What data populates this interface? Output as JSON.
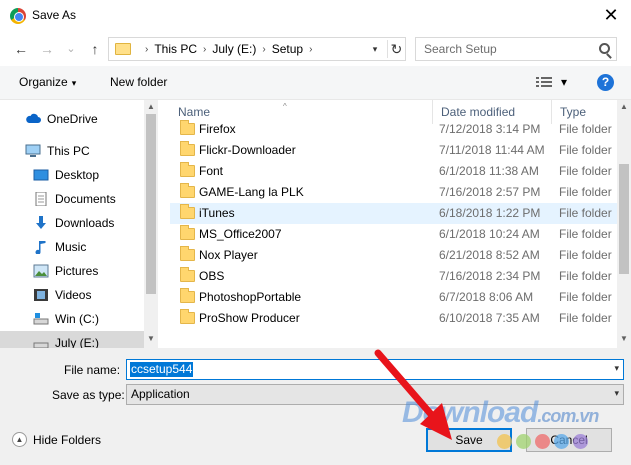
{
  "window": {
    "title": "Save As",
    "close_glyph": "✕"
  },
  "nav": {
    "back_glyph": "←",
    "forward_glyph": "→",
    "recent_glyph": "⌄",
    "up_glyph": "↑",
    "breadcrumbs": [
      "This PC",
      "July (E:)",
      "Setup"
    ],
    "sep_glyph": "›",
    "dropdown_glyph": "▾",
    "refresh_glyph": "↻",
    "search_placeholder": "Search Setup"
  },
  "toolbar": {
    "organize_label": "Organize",
    "dropdown_glyph": "▾",
    "new_folder_label": "New folder",
    "help_glyph": "?"
  },
  "sidebar": {
    "items": [
      {
        "label": "OneDrive",
        "icon": "cloud-icon"
      },
      {
        "label": "This PC",
        "icon": "computer-icon"
      },
      {
        "label": "Desktop",
        "icon": "desktop-icon"
      },
      {
        "label": "Documents",
        "icon": "documents-icon"
      },
      {
        "label": "Downloads",
        "icon": "download-icon"
      },
      {
        "label": "Music",
        "icon": "music-icon"
      },
      {
        "label": "Pictures",
        "icon": "pictures-icon"
      },
      {
        "label": "Videos",
        "icon": "videos-icon"
      },
      {
        "label": "Win (C:)",
        "icon": "drive-icon"
      },
      {
        "label": "July (E:)",
        "icon": "drive-icon"
      }
    ],
    "scroll_up_glyph": "▲",
    "scroll_down_glyph": "▼"
  },
  "file_list": {
    "columns": {
      "name": "Name",
      "date": "Date modified",
      "type": "Type"
    },
    "sort_glyph": "^",
    "rows": [
      {
        "name": "Firefox",
        "date": "7/12/2018 3:14 PM",
        "type": "File folder"
      },
      {
        "name": "Flickr-Downloader",
        "date": "7/11/2018 11:44 AM",
        "type": "File folder"
      },
      {
        "name": "Font",
        "date": "6/1/2018 11:38 AM",
        "type": "File folder"
      },
      {
        "name": "GAME-Lang la PLK",
        "date": "7/16/2018 2:57 PM",
        "type": "File folder"
      },
      {
        "name": "iTunes",
        "date": "6/18/2018 1:22 PM",
        "type": "File folder"
      },
      {
        "name": "MS_Office2007",
        "date": "6/1/2018 10:24 AM",
        "type": "File folder"
      },
      {
        "name": "Nox Player",
        "date": "6/21/2018 8:52 AM",
        "type": "File folder"
      },
      {
        "name": "OBS",
        "date": "7/16/2018 2:34 PM",
        "type": "File folder"
      },
      {
        "name": "PhotoshopPortable",
        "date": "6/7/2018 8:06 AM",
        "type": "File folder"
      },
      {
        "name": "ProShow Producer",
        "date": "6/10/2018 7:35 AM",
        "type": "File folder"
      }
    ],
    "highlight_row": "iTunes"
  },
  "form": {
    "file_name_label": "File name:",
    "file_name_value": "ccsetup544",
    "save_type_label": "Save as type:",
    "save_type_value": "Application",
    "dropdown_glyph": "▾"
  },
  "footer": {
    "hide_folders_label": "Hide Folders",
    "hide_glyph": "▲",
    "save_label": "Save",
    "cancel_label": "Cancel"
  },
  "watermark": {
    "text": "Download",
    "suffix": ".com.vn"
  },
  "colors": {
    "accent": "#0078d7",
    "arrow": "#e8141b",
    "highlight": "#e5f3ff"
  }
}
